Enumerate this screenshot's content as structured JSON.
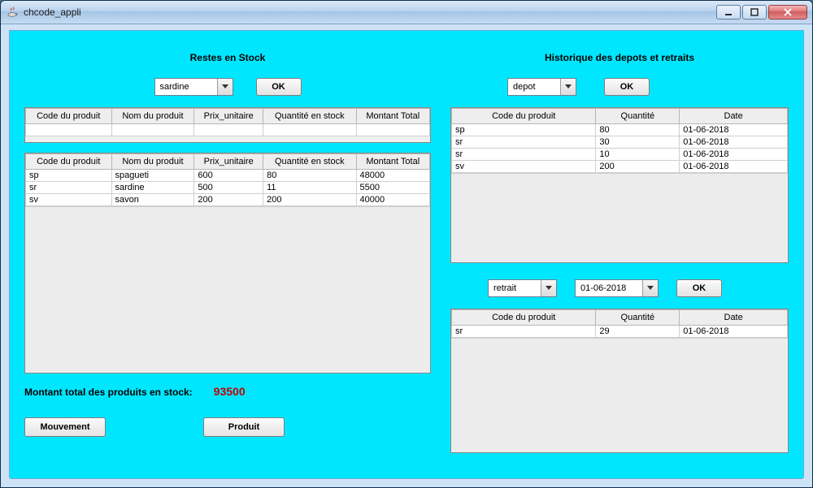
{
  "window": {
    "title": "chcode_appli"
  },
  "left": {
    "title": "Restes en Stock",
    "combo_value": "sardine",
    "ok_label": "OK",
    "table1": {
      "headers": [
        "Code du produit",
        "Nom du produit",
        "Prix_unitaire",
        "Quantité en stock",
        "Montant Total"
      ]
    },
    "table2": {
      "headers": [
        "Code du produit",
        "Nom du produit",
        "Prix_unitaire",
        "Quantité en stock",
        "Montant Total"
      ],
      "rows": [
        [
          "sp",
          "spagueti",
          "600",
          "80",
          "48000"
        ],
        [
          "sr",
          "sardine",
          "500",
          "11",
          "5500"
        ],
        [
          "sv",
          "savon",
          "200",
          "200",
          "40000"
        ]
      ]
    },
    "total_label": "Montant total des produits en stock:",
    "total_value": "93500",
    "btn_mouvement": "Mouvement",
    "btn_produit": "Produit"
  },
  "right": {
    "title": "Historique des depots et retraits",
    "top": {
      "combo_value": "depot",
      "ok_label": "OK",
      "headers": [
        "Code du produit",
        "Quantité",
        "Date"
      ],
      "rows": [
        [
          "sp",
          "80",
          "01-06-2018"
        ],
        [
          "sr",
          "30",
          "01-06-2018"
        ],
        [
          "sr",
          "10",
          "01-06-2018"
        ],
        [
          "sv",
          "200",
          "01-06-2018"
        ]
      ]
    },
    "bottom": {
      "combo1_value": "retrait",
      "combo2_value": "01-06-2018",
      "ok_label": "OK",
      "headers": [
        "Code du produit",
        "Quantité",
        "Date"
      ],
      "rows": [
        [
          "sr",
          "29",
          "01-06-2018"
        ]
      ]
    }
  }
}
